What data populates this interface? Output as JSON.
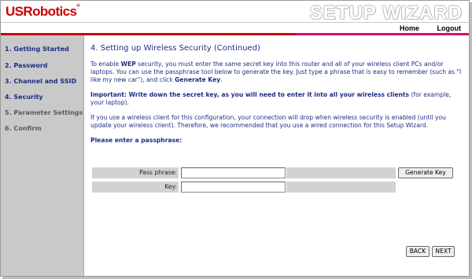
{
  "header": {
    "brand": "USRobotics",
    "brand_mark": "®",
    "wizard_title": "SETUP WIZARD",
    "nav": {
      "home": "Home",
      "logout": "Logout"
    },
    "colors": {
      "brand": "#cc0000",
      "accent": "#e0007a"
    }
  },
  "sidebar": {
    "items": [
      {
        "label": "1. Getting Started"
      },
      {
        "label": "2. Password"
      },
      {
        "label": "3. Channel and SSID"
      },
      {
        "label": "4. Security"
      },
      {
        "label": "5. Parameter Settings"
      },
      {
        "label": "6. Confirm"
      }
    ]
  },
  "main": {
    "title": "4. Setting up Wireless Security (Continued)",
    "intro": {
      "p1": "To enable ",
      "wep": "WEP",
      "p2": " security, you must enter the same secret key into this router and all of your wireless client PCs and/or laptops. You can use the passphrase tool below to generate the key. Just type a phrase that is easy to remember (such as \"I like my new car\"), and click ",
      "generate": "Generate Key",
      "p3": "."
    },
    "important": {
      "bold": "Important: Write down the secret key, as you will need to enter it into all your wireless clients",
      "rest": " (for example, your laptop)."
    },
    "warning": "If you use a wireless client for this configuration, your connection will drop when wireless security is enabled (until you update your wireless client). Therefore, we recommended that you use a wired connection for this Setup Wizard.",
    "prompt": "Please enter a passphrase:",
    "form": {
      "passphrase_label": "Pass phrase:",
      "passphrase_value": "",
      "key_label": "Key:",
      "key_value": "",
      "generate_button": "Generate Key"
    },
    "buttons": {
      "back": "BACK",
      "next": "NEXT"
    }
  }
}
